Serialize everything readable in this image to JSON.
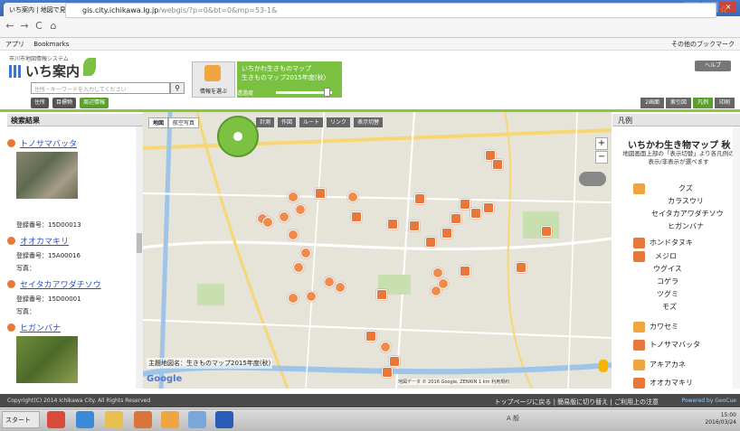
{
  "browser": {
    "tab_title": "いち案内 | 地図で見る市川",
    "url_host": "gis.city.ichikawa.lg.jp",
    "url_path": "/webgis/?p=0&bt=0&mp=53-1&",
    "bookmarks": [
      "アプリ",
      "Bookmarks"
    ],
    "bookmarks_right": "その他のブックマーク"
  },
  "site": {
    "system_name": "市川市地図情報システム",
    "logo_text": "いち案内",
    "search_placeholder": "住所・キーワードを入力してください",
    "categories": [
      "住所",
      "目標物",
      "周辺情報"
    ],
    "info_label": "情報を選ぶ",
    "map_select_line1": "いちかわ生きものマップ",
    "map_select_line2": "生きものマップ2015年度(秋)",
    "opacity_label": "透過度",
    "help": "ヘルプ",
    "tools": [
      "2画面",
      "索引図",
      "凡例",
      "印刷"
    ]
  },
  "left_panel": {
    "header": "検索結果",
    "results": [
      {
        "name": "トノサマバッタ",
        "reg_label": "登録番号：",
        "reg": "15D00013"
      },
      {
        "name": "オオカマキリ",
        "reg_label": "登録番号：",
        "reg": "15A00016",
        "photo_label": "写真："
      },
      {
        "name": "セイタカアワダチソウ",
        "reg_label": "登録番号：",
        "reg": "15D00001",
        "photo_label": "写真："
      },
      {
        "name": "ヒガンバナ"
      }
    ]
  },
  "map": {
    "tabs": [
      "地図",
      "航空写真"
    ],
    "tools": [
      "計測",
      "作図",
      "ルート",
      "リンク",
      "表示切替"
    ],
    "zoom_in": "+",
    "zoom_out": "−",
    "bottom_label": "主題地図名：生きものマップ2015年度(秋)",
    "google": "Google",
    "copyright": "地図データ © 2016 Google, ZENRIN",
    "scale": "1 km",
    "terms": "利用規約"
  },
  "legend": {
    "header": "凡例",
    "title": "いちかわ生き物マップ 秋",
    "note": "地図画面上部の「表示切替」より各凡例の表示/非表示が選べます",
    "items": [
      {
        "lines": [
          "クズ",
          "カラスウリ",
          "セイタカアワダチソウ",
          "ヒガンバナ"
        ]
      },
      {
        "lines": [
          "ホンドタヌキ"
        ]
      },
      {
        "lines": [
          "メジロ",
          "ウグイス",
          "コゲラ",
          "ツグミ",
          "モズ"
        ]
      },
      {
        "lines": [
          "カワセミ"
        ]
      },
      {
        "lines": [
          "トノサマバッタ"
        ]
      },
      {
        "lines": [
          "アキアカネ"
        ]
      },
      {
        "lines": [
          "オオカマキリ"
        ]
      }
    ]
  },
  "footer": {
    "copyright": "Copyright(C) 2014 Ichikawa City. All Rights Reserved",
    "links": "トップページに戻る | 簡易版に切り替え | ご利用上の注意",
    "powered": "Powered by GeoCue"
  },
  "taskbar": {
    "start": "スタート",
    "time": "15:00",
    "date": "2016/03/24",
    "ime": "A 般"
  },
  "colors": {
    "accent_green": "#7ac142",
    "marker_orange": "#e8783a",
    "link_blue": "#2a4fbf"
  }
}
